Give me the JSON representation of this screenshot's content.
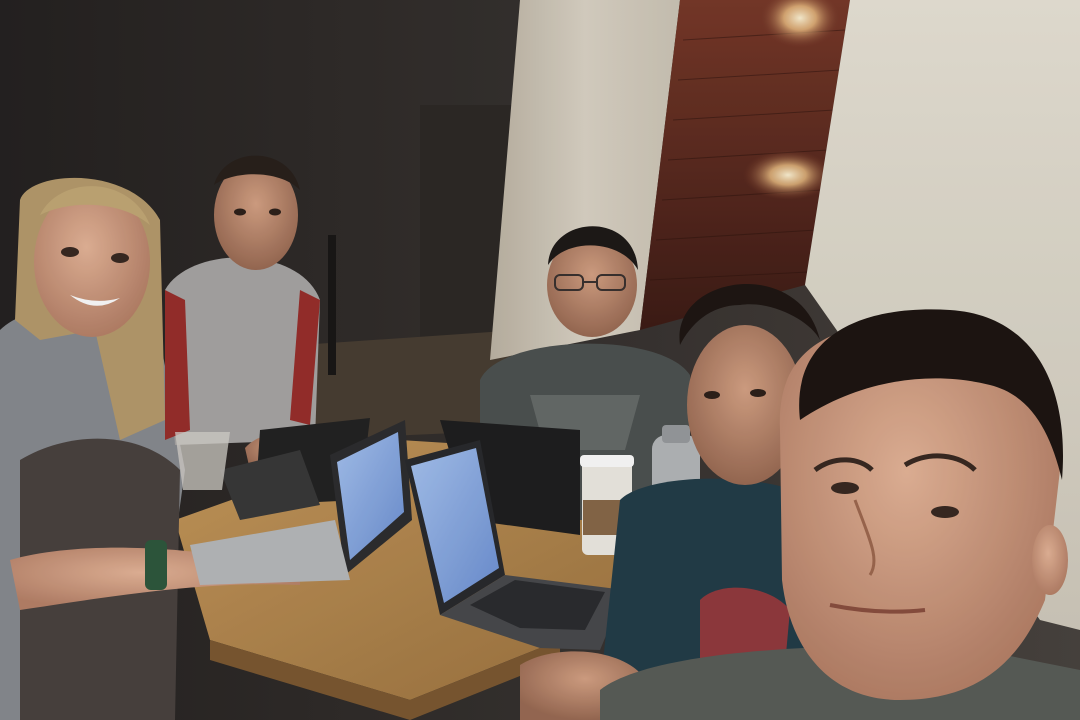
{
  "scene": {
    "subject": "group-selfie-at-table-with-laptops",
    "people_count": 5,
    "laptop_count": 4,
    "colors": {
      "back_wall": "#2a2624",
      "pillar": "#d6cfc2",
      "right_wall": "#e2ddd0",
      "wood_panel": "#5a2a20",
      "table_top": "#b58a52",
      "screen_glow": "#8fb3ea",
      "lamp": "#ffe6b0"
    }
  }
}
